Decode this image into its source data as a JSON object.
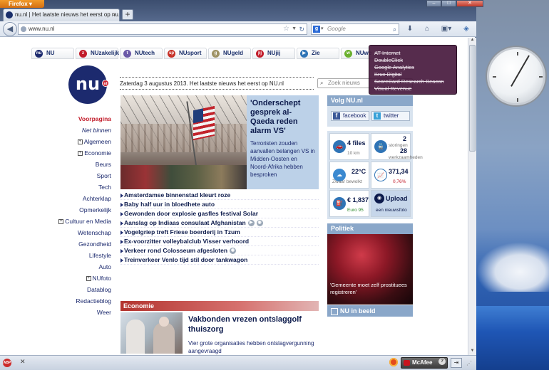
{
  "browser": {
    "app_label": "Firefox",
    "tab_title": "nu.nl | Het laatste nieuws het eerst op nu.nl",
    "new_tab": "+",
    "url": "www.nu.nl",
    "search_placeholder": "Google",
    "search_engine_letter": "g"
  },
  "site": {
    "logo": "nu",
    "logo_badge": "nl",
    "nav_tabs": [
      {
        "label": "NU",
        "icon_color": "#1c2a6e",
        "icon_text": "nu"
      },
      {
        "label": "NUzakelijk",
        "icon_color": "#c21c2a",
        "icon_text": "z"
      },
      {
        "label": "NUtech",
        "icon_color": "#6b5aa8",
        "icon_text": "t"
      },
      {
        "label": "NUsport",
        "icon_color": "#c73128",
        "icon_text": "sp"
      },
      {
        "label": "NUgeld",
        "icon_color": "#9e9264",
        "icon_text": "g"
      },
      {
        "label": "NUjij",
        "icon_color": "#c21c2a",
        "icon_text": "jij"
      },
      {
        "label": "Zie",
        "icon_color": "#2f74b6",
        "icon_text": "▶"
      },
      {
        "label": "NUwe",
        "icon_color": "#6ab02f",
        "icon_text": "w"
      }
    ],
    "date_line": "Zaterdag 3 augustus 2013. Het laatste nieuws het eerst op NU.nl",
    "search_placeholder": "Zoek nieuws",
    "left_nav": [
      {
        "label": "Voorpagina",
        "style": "active",
        "plus": false
      },
      {
        "label": "Net binnen",
        "style": "italic",
        "plus": false
      },
      {
        "label": "Algemeen",
        "style": "normal",
        "plus": true
      },
      {
        "label": "Economie",
        "style": "normal",
        "plus": true
      },
      {
        "label": "Beurs",
        "style": "normal",
        "plus": false
      },
      {
        "label": "Sport",
        "style": "normal",
        "plus": false
      },
      {
        "label": "Tech",
        "style": "normal",
        "plus": false
      },
      {
        "label": "Achterklap",
        "style": "normal",
        "plus": false
      },
      {
        "label": "Opmerkelijk",
        "style": "normal",
        "plus": false
      },
      {
        "label": "Cultuur en Media",
        "style": "normal",
        "plus": true
      },
      {
        "label": "Wetenschap",
        "style": "normal",
        "plus": false
      },
      {
        "label": "Gezondheid",
        "style": "normal",
        "plus": false
      },
      {
        "label": "Lifestyle",
        "style": "normal",
        "plus": false
      },
      {
        "label": "Auto",
        "style": "normal",
        "plus": false
      },
      {
        "label": "NUfoto",
        "style": "normal",
        "plus": true
      },
      {
        "label": "Datablog",
        "style": "normal",
        "plus": false
      },
      {
        "label": "Redactieblog",
        "style": "normal",
        "plus": false
      },
      {
        "label": "Weer",
        "style": "normal",
        "plus": false
      }
    ],
    "hero": {
      "headline": "'Onderschept gesprek al-Qaeda reden alarm VS'",
      "summary": "Terroristen zouden aanvallen belangen VS in Midden-Oosten en Noord-Afrika hebben besproken"
    },
    "news_items": [
      {
        "title": "Amsterdamse binnenstad kleurt roze",
        "icons": []
      },
      {
        "title": "Baby half uur in bloedhete auto",
        "icons": []
      },
      {
        "title": "Gewonden door explosie gasfles festival Solar",
        "icons": []
      },
      {
        "title": "Aanslag op Indiaas consulaat Afghanistan",
        "icons": [
          "▶",
          "◉"
        ]
      },
      {
        "title": "Vogelgriep treft Friese boerderij in Tzum",
        "icons": []
      },
      {
        "title": "Ex-voorzitter volleybalclub Visser verhoord",
        "icons": []
      },
      {
        "title": "Verkeer rond Colosseum afgesloten",
        "icons": [
          "◉"
        ]
      },
      {
        "title": "Treinverkeer Venlo tijd stil door tankwagon",
        "icons": []
      }
    ],
    "economie": {
      "header": "Economie",
      "headline": "Vakbonden vrezen ontslaggolf thuiszorg",
      "summary": "Vier grote organisaties hebben ontslagvergunning aangevraagd"
    },
    "volg": {
      "title": "Volg NU.nl",
      "facebook": "facebook",
      "twitter": "twitter"
    },
    "widgets": {
      "files": {
        "value": "4 files",
        "sub": "10 km"
      },
      "trains": {
        "value1": "2",
        "sub1": "storingen",
        "value2": "28",
        "sub2": "werkzaamheden"
      },
      "weather": {
        "value": "22°C",
        "sub": "Zwaar bewolkt"
      },
      "aex": {
        "value": "371,34",
        "sub": "0,76%"
      },
      "fuel": {
        "value": "€ 1,837",
        "sub": "Euro 95"
      },
      "upload": {
        "value": "Upload",
        "sub": "een nieuwsfoto"
      }
    },
    "politiek": {
      "title": "Politiek",
      "caption": "'Gemeente moet zelf prostituees registreren'"
    },
    "in_beeld": "NU in beeld"
  },
  "tracker_popup": [
    "AT Internet",
    "DoubleClick",
    "Google Analytics",
    "Krux Digital",
    "ScoreCard Research Beacon",
    "Visual Revenue"
  ],
  "statusbar": {
    "mcafee": "McAfee",
    "help": "?"
  },
  "colors": {
    "brand": "#1c2a6e",
    "accent_red": "#c21c2a",
    "panel_blue": "#8aa7c9"
  }
}
